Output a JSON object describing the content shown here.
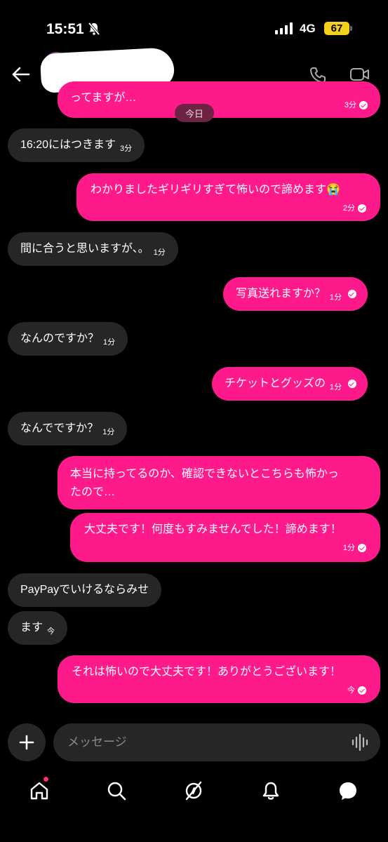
{
  "status": {
    "time": "15:51",
    "network": "4G",
    "battery": "67"
  },
  "header": {
    "contact_name": ""
  },
  "today_label": "今日",
  "messages": [
    {
      "dir": "out",
      "text": "ってますが…",
      "time": "3分"
    },
    {
      "dir": "in",
      "text": "16:20にはつきます",
      "time": "3分"
    },
    {
      "dir": "out",
      "text": "わかりましたギリギリすぎて怖いので諦めます😭",
      "time": "2分"
    },
    {
      "dir": "in",
      "text": "間に合うと思いますが、。",
      "time": "1分"
    },
    {
      "dir": "out",
      "text": "写真送れますか？",
      "time": "1分"
    },
    {
      "dir": "in",
      "text": "なんのですか？",
      "time": "1分"
    },
    {
      "dir": "out",
      "text": "チケットとグッズの",
      "time": "1分"
    },
    {
      "dir": "in",
      "text": "なんでですか？",
      "time": "1分"
    },
    {
      "dir": "out",
      "text_line1": "本当に持ってるのか、確認できないとこちらも怖かっ",
      "text_line2": "たので…",
      "time": ""
    },
    {
      "dir": "out",
      "text": "大丈夫です！何度もすみませんでした！諦めます！",
      "time": "1分"
    },
    {
      "dir": "in",
      "text": "PayPayでいけるならみせ",
      "time": ""
    },
    {
      "dir": "in",
      "text": "ます",
      "time": "今"
    },
    {
      "dir": "out",
      "text": "それは怖いので大丈夫です！ありがとうございます！",
      "time": "今"
    }
  ],
  "composer": {
    "placeholder": "メッセージ"
  },
  "icons": {
    "back": "arrow-left-icon",
    "call": "phone-icon",
    "video": "video-camera-icon",
    "plus": "plus-icon",
    "mic": "voice-wave-icon",
    "tabs": [
      "home-icon",
      "search-icon",
      "explore-icon",
      "notifications-icon",
      "messages-icon"
    ]
  },
  "colors": {
    "outgoing": "#ff1a8c",
    "incoming": "#262626",
    "background": "#000000",
    "today_pill": "#6e2344"
  }
}
